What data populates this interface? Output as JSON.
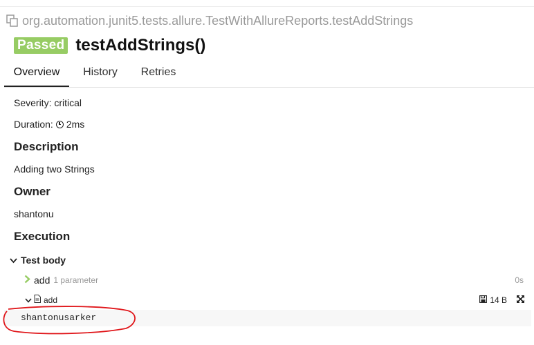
{
  "header": {
    "full_name": "org.automation.junit5.tests.allure.TestWithAllureReports.testAddStrings",
    "status": "Passed",
    "title": "testAddStrings()"
  },
  "tabs": [
    {
      "label": "Overview",
      "active": true
    },
    {
      "label": "History",
      "active": false
    },
    {
      "label": "Retries",
      "active": false
    }
  ],
  "overview": {
    "severity": "Severity: critical",
    "duration_label": "Duration:",
    "duration_value": "2ms",
    "description_heading": "Description",
    "description_text": "Adding two Strings",
    "owner_heading": "Owner",
    "owner_text": "shantonu",
    "execution_heading": "Execution",
    "test_body_label": "Test body"
  },
  "step": {
    "name": "add",
    "parameters": "1 parameter",
    "duration": "0s"
  },
  "attachment": {
    "name": "add",
    "size": "14 B",
    "content": "shantonusarker"
  },
  "colors": {
    "passed": "#97cc64",
    "annotation": "#e0171b"
  }
}
